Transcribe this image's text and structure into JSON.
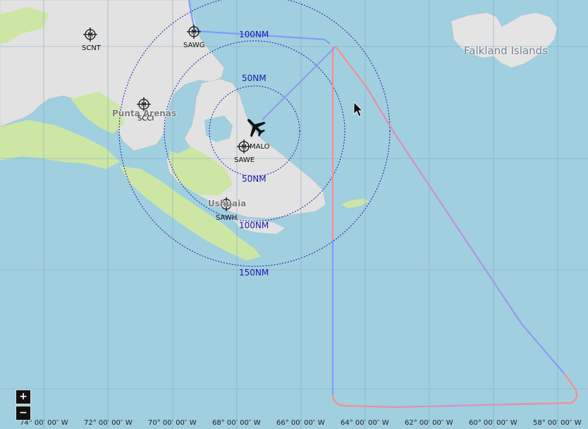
{
  "map": {
    "places": [
      {
        "id": "falkland",
        "text": "Falkland Islands"
      },
      {
        "id": "punta-arenas",
        "text": "Punta Arenas"
      },
      {
        "id": "ushuaia",
        "text": "Ushuaia"
      }
    ],
    "airports": [
      {
        "code": "SCNT"
      },
      {
        "code": "SAWG"
      },
      {
        "code": "SCCI"
      },
      {
        "code": "SAWE"
      },
      {
        "code": "SAWH"
      }
    ],
    "navaid": {
      "code": "MALO"
    },
    "range_rings": {
      "labels": [
        "50NM",
        "100NM",
        "150NM"
      ]
    },
    "longitude_labels": [
      "74° 00′ 00″ W",
      "72° 00′ 00″ W",
      "70° 00′ 00″ W",
      "68° 00′ 00″ W",
      "66° 00′ 00″ W",
      "64° 00′ 00″ W",
      "62° 00′ 00″ W",
      "60° 00′ 00″ W",
      "58° 00′ 00″ W"
    ],
    "colors": {
      "water": "#a0cfdf",
      "land": "#e2e2e2",
      "vegetation": "#cde6a4",
      "route_blue": "#7f9cff",
      "route_red": "#ff8a8a",
      "range_ring": "#1a1aa8"
    },
    "icons": [
      "airport-icon",
      "aircraft-icon",
      "cursor-icon"
    ]
  },
  "controls": {
    "zoom_in": "+",
    "zoom_out": "−"
  }
}
